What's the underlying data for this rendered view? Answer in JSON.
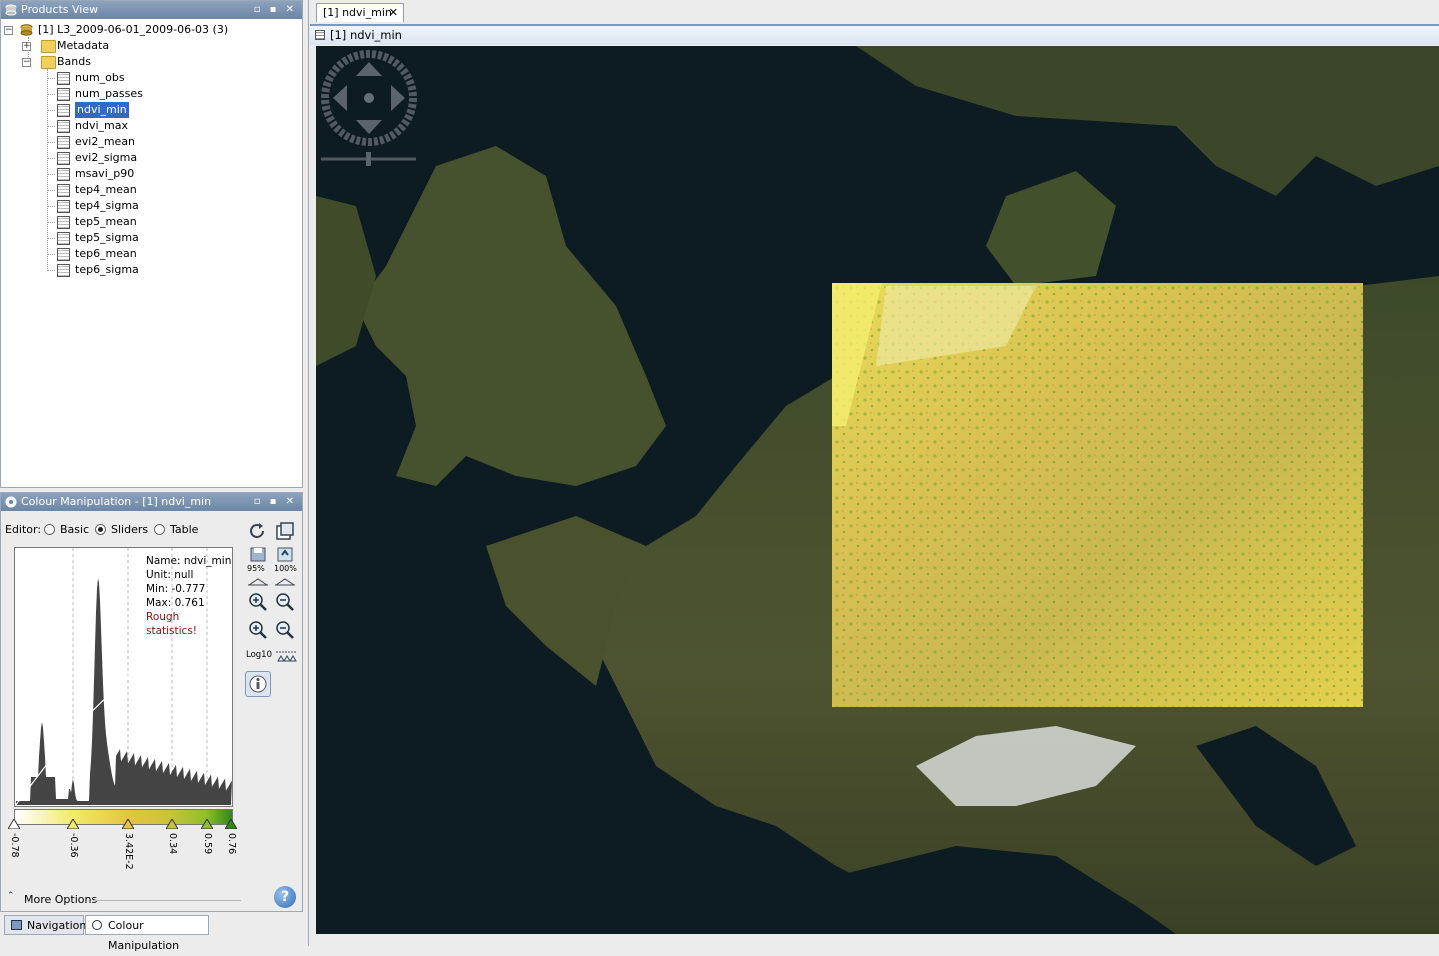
{
  "products_view": {
    "title": "Products View",
    "product": "[1] L3_2009-06-01_2009-06-03 (3)",
    "metadata": "Metadata",
    "bands_folder": "Bands",
    "bands": [
      "num_obs",
      "num_passes",
      "ndvi_min",
      "ndvi_max",
      "evi2_mean",
      "evi2_sigma",
      "msavi_p90",
      "tep4_mean",
      "tep4_sigma",
      "tep5_mean",
      "tep5_sigma",
      "tep6_mean",
      "tep6_sigma"
    ],
    "selected_band": "ndvi_min"
  },
  "colour": {
    "title": "Colour Manipulation - [1] ndvi_min",
    "editor_label": "Editor:",
    "editors": [
      "Basic",
      "Sliders",
      "Table"
    ],
    "selected_editor": "Sliders",
    "stats": {
      "name": "Name: ndvi_min",
      "unit": "Unit: null",
      "min": "Min: -0.777",
      "max": "Max: 0.761",
      "warning": "Rough statistics!"
    },
    "slider_labels": [
      "-0.78",
      "-0.36",
      "3.42E-2",
      "0.34",
      "0.59",
      "0.76"
    ],
    "slider_colors": [
      "#ffffff",
      "#f2e96a",
      "#e6c440",
      "#c7c43a",
      "#8fbe2e",
      "#2f8a12"
    ],
    "tools": {
      "pct95": "95%",
      "pct100": "100%",
      "log": "Log10"
    },
    "more_options": "More Options"
  },
  "bottom_tabs": [
    "Navigation",
    "Colour Manipulation"
  ],
  "document": {
    "tab_label": "[1] ndvi_min",
    "view_title": "[1] ndvi_min"
  },
  "accent": "#316ac5"
}
